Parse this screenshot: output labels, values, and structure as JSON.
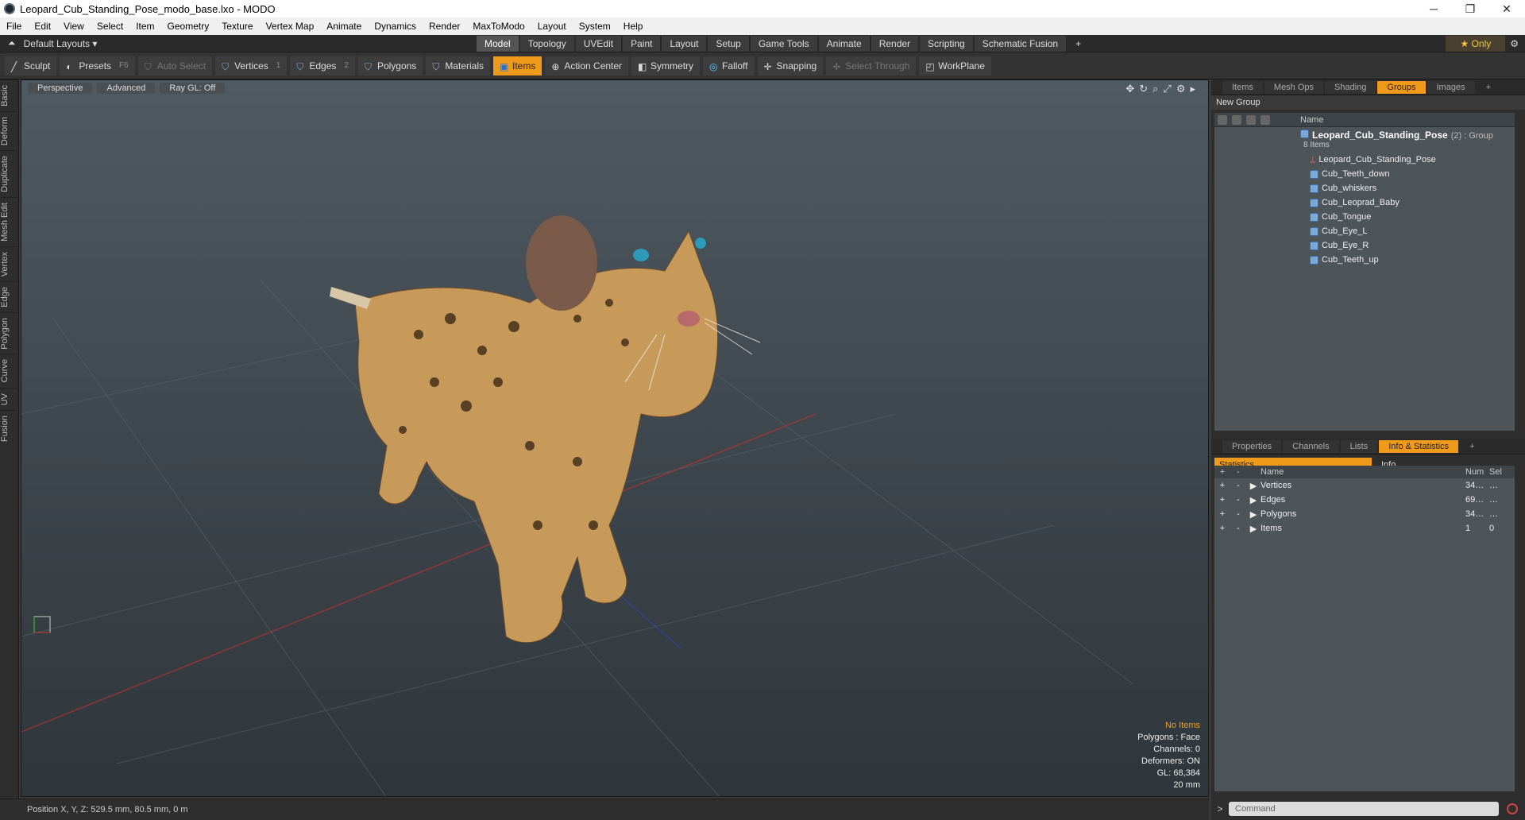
{
  "window": {
    "title": "Leopard_Cub_Standing_Pose_modo_base.lxo - MODO",
    "minimize": "─",
    "maximize": "❐",
    "close": "✕"
  },
  "menu": [
    "File",
    "Edit",
    "View",
    "Select",
    "Item",
    "Geometry",
    "Texture",
    "Vertex Map",
    "Animate",
    "Dynamics",
    "Render",
    "MaxToModo",
    "Layout",
    "System",
    "Help"
  ],
  "layouts": "Default Layouts ▾",
  "tabs": [
    "Model",
    "Topology",
    "UVEdit",
    "Paint",
    "Layout",
    "Setup",
    "Game Tools",
    "Animate",
    "Render",
    "Scripting",
    "Schematic Fusion"
  ],
  "tabs_add": "+",
  "only_label": "★ Only",
  "toolbar": {
    "sculpt": "Sculpt",
    "presets": "Presets",
    "presets_key": "F6",
    "auto_select": "Auto Select",
    "vertices": "Vertices",
    "vertices_num": "1",
    "edges": "Edges",
    "edges_num": "2",
    "polygons": "Polygons",
    "materials": "Materials",
    "items": "Items",
    "action_center": "Action Center",
    "symmetry": "Symmetry",
    "falloff": "Falloff",
    "snapping": "Snapping",
    "select_through": "Select Through",
    "workplane": "WorkPlane"
  },
  "left_tabs": [
    "Basic",
    "Deform",
    "Duplicate",
    "Mesh Edit",
    "Vertex",
    "Edge",
    "Polygon",
    "Curve",
    "UV",
    "Fusion"
  ],
  "viewport": {
    "view": "Perspective",
    "shading": "Advanced",
    "raygl": "Ray GL: Off",
    "info": {
      "selection": "No Items",
      "polygons": "Polygons : Face",
      "channels": "Channels: 0",
      "deformers": "Deformers: ON",
      "gl": "GL: 68,384",
      "scale": "20 mm"
    }
  },
  "status": {
    "position": "Position X, Y, Z:   529.5 mm, 80.5 mm, 0 m"
  },
  "upper_tabs": [
    "Items",
    "Mesh Ops",
    "Shading",
    "Groups",
    "Images",
    "+"
  ],
  "new_group": "New Group",
  "tree": {
    "name_col": "Name",
    "root": "Leopard_Cub_Standing_Pose",
    "root_count": "(2) : Group",
    "root_sub": "8 Items",
    "items": [
      "Leopard_Cub_Standing_Pose",
      "Cub_Teeth_down",
      "Cub_whiskers",
      "Cub_Leoprad_Baby",
      "Cub_Tongue",
      "Cub_Eye_L",
      "Cub_Eye_R",
      "Cub_Teeth_up"
    ]
  },
  "lower_tabs": [
    "Properties",
    "Channels",
    "Lists",
    "Info & Statistics",
    "+"
  ],
  "stats": {
    "tab_statistics": "Statistics",
    "tab_info": "Info",
    "col_name": "Name",
    "col_num": "Num",
    "col_sel": "Sel",
    "rows": [
      {
        "name": "Vertices",
        "num": "34…",
        "sel": "…"
      },
      {
        "name": "Edges",
        "num": "69…",
        "sel": "…"
      },
      {
        "name": "Polygons",
        "num": "34…",
        "sel": "…"
      },
      {
        "name": "Items",
        "num": "1",
        "sel": "0"
      }
    ]
  },
  "command_placeholder": "Command"
}
